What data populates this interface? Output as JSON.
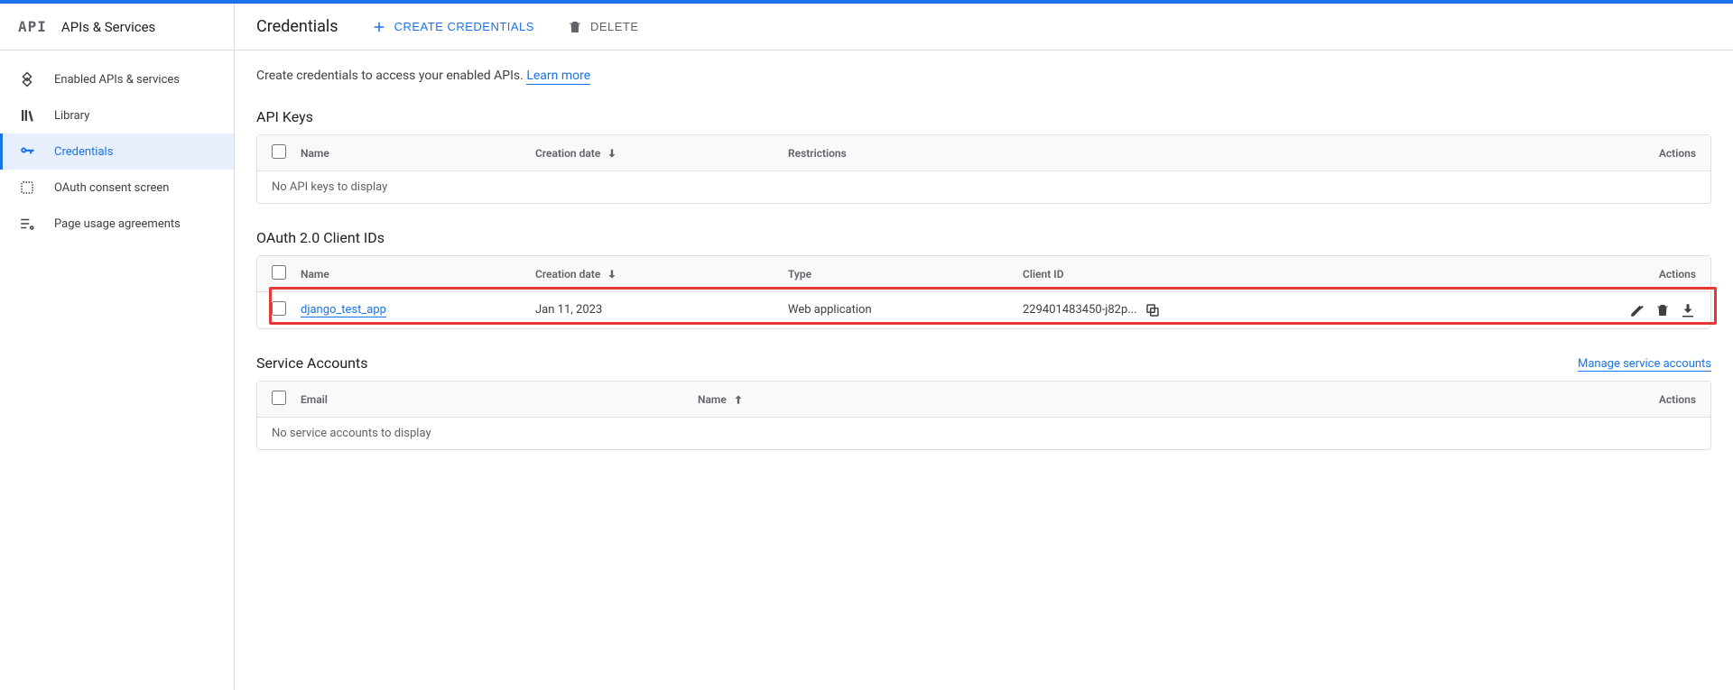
{
  "sidebar": {
    "logo": "API",
    "title": "APIs & Services",
    "items": [
      {
        "label": "Enabled APIs & services"
      },
      {
        "label": "Library"
      },
      {
        "label": "Credentials"
      },
      {
        "label": "OAuth consent screen"
      },
      {
        "label": "Page usage agreements"
      }
    ],
    "active_index": 2
  },
  "toolbar": {
    "title": "Credentials",
    "create_label": "CREATE CREDENTIALS",
    "delete_label": "DELETE"
  },
  "intro": {
    "text": "Create credentials to access your enabled APIs. ",
    "learn_more": "Learn more"
  },
  "sections": {
    "api_keys": {
      "title": "API Keys",
      "columns": {
        "name": "Name",
        "creation": "Creation date",
        "restrictions": "Restrictions",
        "actions": "Actions"
      },
      "empty": "No API keys to display"
    },
    "oauth": {
      "title": "OAuth 2.0 Client IDs",
      "columns": {
        "name": "Name",
        "creation": "Creation date",
        "type": "Type",
        "client_id": "Client ID",
        "actions": "Actions"
      },
      "rows": [
        {
          "name": "django_test_app",
          "date": "Jan 11, 2023",
          "type": "Web application",
          "client_id": "229401483450-j82p..."
        }
      ]
    },
    "service": {
      "title": "Service Accounts",
      "manage": "Manage service accounts",
      "columns": {
        "email": "Email",
        "name": "Name",
        "actions": "Actions"
      },
      "empty": "No service accounts to display"
    }
  }
}
